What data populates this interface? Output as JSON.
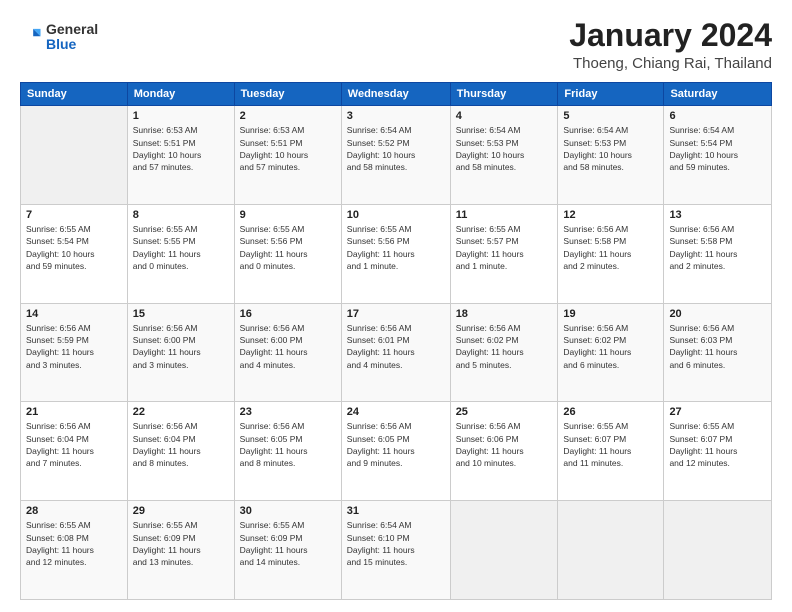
{
  "header": {
    "logo": {
      "general": "General",
      "blue": "Blue"
    },
    "month": "January 2024",
    "location": "Thoeng, Chiang Rai, Thailand"
  },
  "weekdays": [
    "Sunday",
    "Monday",
    "Tuesday",
    "Wednesday",
    "Thursday",
    "Friday",
    "Saturday"
  ],
  "weeks": [
    [
      {
        "day": "",
        "info": ""
      },
      {
        "day": "1",
        "info": "Sunrise: 6:53 AM\nSunset: 5:51 PM\nDaylight: 10 hours\nand 57 minutes."
      },
      {
        "day": "2",
        "info": "Sunrise: 6:53 AM\nSunset: 5:51 PM\nDaylight: 10 hours\nand 57 minutes."
      },
      {
        "day": "3",
        "info": "Sunrise: 6:54 AM\nSunset: 5:52 PM\nDaylight: 10 hours\nand 58 minutes."
      },
      {
        "day": "4",
        "info": "Sunrise: 6:54 AM\nSunset: 5:53 PM\nDaylight: 10 hours\nand 58 minutes."
      },
      {
        "day": "5",
        "info": "Sunrise: 6:54 AM\nSunset: 5:53 PM\nDaylight: 10 hours\nand 58 minutes."
      },
      {
        "day": "6",
        "info": "Sunrise: 6:54 AM\nSunset: 5:54 PM\nDaylight: 10 hours\nand 59 minutes."
      }
    ],
    [
      {
        "day": "7",
        "info": "Sunrise: 6:55 AM\nSunset: 5:54 PM\nDaylight: 10 hours\nand 59 minutes."
      },
      {
        "day": "8",
        "info": "Sunrise: 6:55 AM\nSunset: 5:55 PM\nDaylight: 11 hours\nand 0 minutes."
      },
      {
        "day": "9",
        "info": "Sunrise: 6:55 AM\nSunset: 5:56 PM\nDaylight: 11 hours\nand 0 minutes."
      },
      {
        "day": "10",
        "info": "Sunrise: 6:55 AM\nSunset: 5:56 PM\nDaylight: 11 hours\nand 1 minute."
      },
      {
        "day": "11",
        "info": "Sunrise: 6:55 AM\nSunset: 5:57 PM\nDaylight: 11 hours\nand 1 minute."
      },
      {
        "day": "12",
        "info": "Sunrise: 6:56 AM\nSunset: 5:58 PM\nDaylight: 11 hours\nand 2 minutes."
      },
      {
        "day": "13",
        "info": "Sunrise: 6:56 AM\nSunset: 5:58 PM\nDaylight: 11 hours\nand 2 minutes."
      }
    ],
    [
      {
        "day": "14",
        "info": "Sunrise: 6:56 AM\nSunset: 5:59 PM\nDaylight: 11 hours\nand 3 minutes."
      },
      {
        "day": "15",
        "info": "Sunrise: 6:56 AM\nSunset: 6:00 PM\nDaylight: 11 hours\nand 3 minutes."
      },
      {
        "day": "16",
        "info": "Sunrise: 6:56 AM\nSunset: 6:00 PM\nDaylight: 11 hours\nand 4 minutes."
      },
      {
        "day": "17",
        "info": "Sunrise: 6:56 AM\nSunset: 6:01 PM\nDaylight: 11 hours\nand 4 minutes."
      },
      {
        "day": "18",
        "info": "Sunrise: 6:56 AM\nSunset: 6:02 PM\nDaylight: 11 hours\nand 5 minutes."
      },
      {
        "day": "19",
        "info": "Sunrise: 6:56 AM\nSunset: 6:02 PM\nDaylight: 11 hours\nand 6 minutes."
      },
      {
        "day": "20",
        "info": "Sunrise: 6:56 AM\nSunset: 6:03 PM\nDaylight: 11 hours\nand 6 minutes."
      }
    ],
    [
      {
        "day": "21",
        "info": "Sunrise: 6:56 AM\nSunset: 6:04 PM\nDaylight: 11 hours\nand 7 minutes."
      },
      {
        "day": "22",
        "info": "Sunrise: 6:56 AM\nSunset: 6:04 PM\nDaylight: 11 hours\nand 8 minutes."
      },
      {
        "day": "23",
        "info": "Sunrise: 6:56 AM\nSunset: 6:05 PM\nDaylight: 11 hours\nand 8 minutes."
      },
      {
        "day": "24",
        "info": "Sunrise: 6:56 AM\nSunset: 6:05 PM\nDaylight: 11 hours\nand 9 minutes."
      },
      {
        "day": "25",
        "info": "Sunrise: 6:56 AM\nSunset: 6:06 PM\nDaylight: 11 hours\nand 10 minutes."
      },
      {
        "day": "26",
        "info": "Sunrise: 6:55 AM\nSunset: 6:07 PM\nDaylight: 11 hours\nand 11 minutes."
      },
      {
        "day": "27",
        "info": "Sunrise: 6:55 AM\nSunset: 6:07 PM\nDaylight: 11 hours\nand 12 minutes."
      }
    ],
    [
      {
        "day": "28",
        "info": "Sunrise: 6:55 AM\nSunset: 6:08 PM\nDaylight: 11 hours\nand 12 minutes."
      },
      {
        "day": "29",
        "info": "Sunrise: 6:55 AM\nSunset: 6:09 PM\nDaylight: 11 hours\nand 13 minutes."
      },
      {
        "day": "30",
        "info": "Sunrise: 6:55 AM\nSunset: 6:09 PM\nDaylight: 11 hours\nand 14 minutes."
      },
      {
        "day": "31",
        "info": "Sunrise: 6:54 AM\nSunset: 6:10 PM\nDaylight: 11 hours\nand 15 minutes."
      },
      {
        "day": "",
        "info": ""
      },
      {
        "day": "",
        "info": ""
      },
      {
        "day": "",
        "info": ""
      }
    ]
  ]
}
